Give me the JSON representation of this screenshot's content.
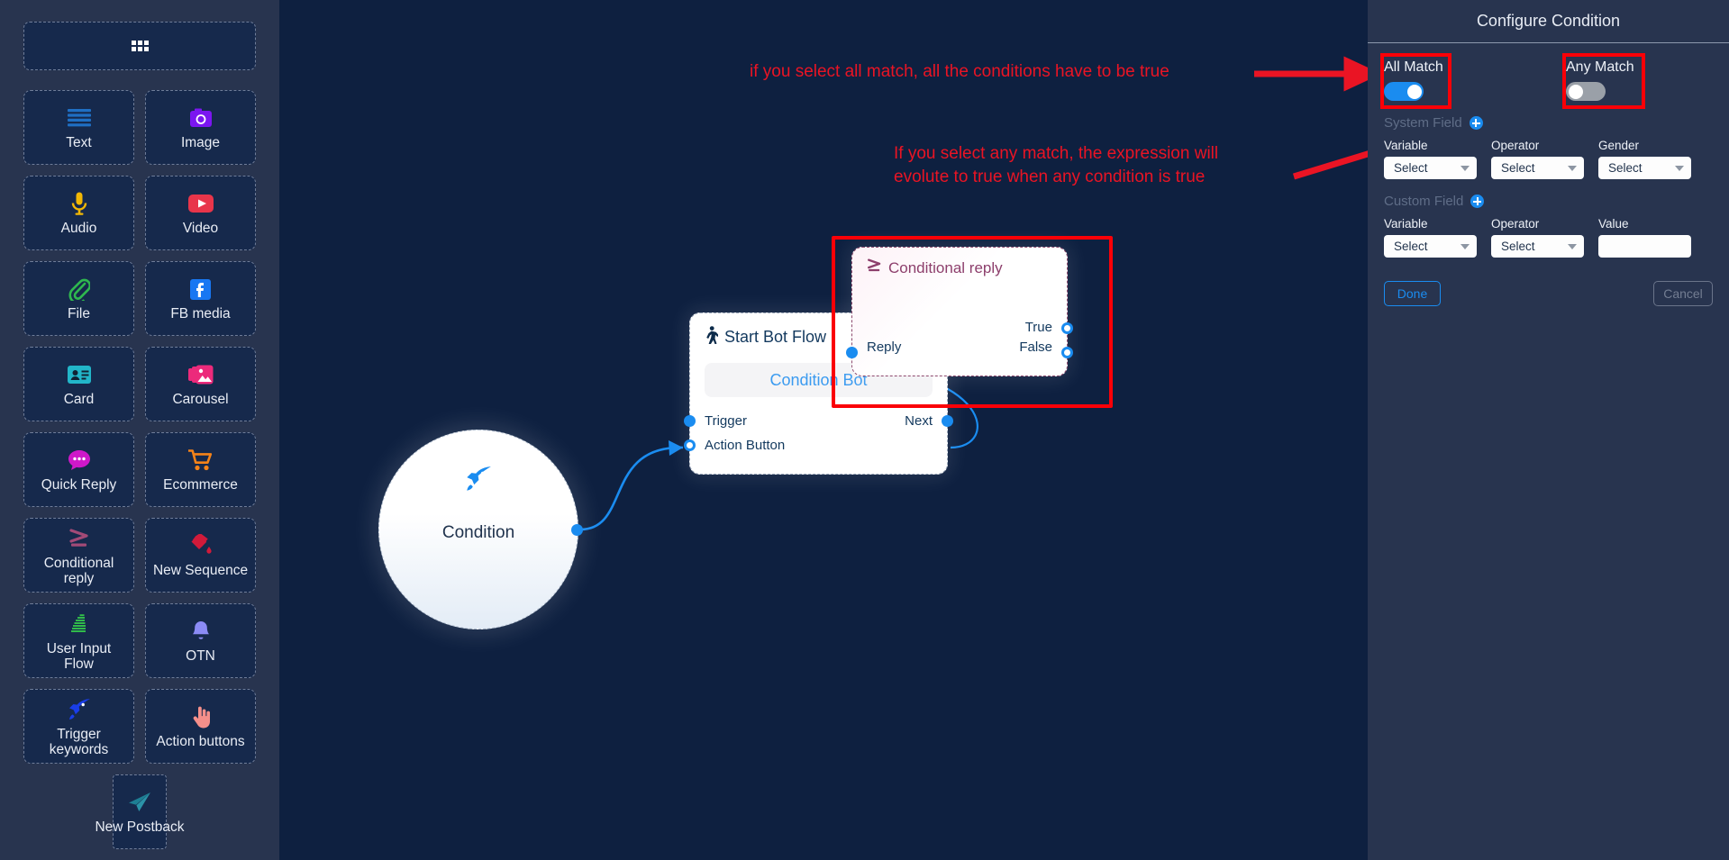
{
  "sidebar": {
    "grid_button": {
      "icon": "grid-icon"
    },
    "tiles": [
      {
        "label": "Text",
        "icon": "lines-icon",
        "color": "#1f6fc4"
      },
      {
        "label": "Image",
        "icon": "camera-icon",
        "color": "#7b16f0"
      },
      {
        "label": "Audio",
        "icon": "microphone-icon",
        "color": "#f2b705"
      },
      {
        "label": "Video",
        "icon": "youtube-icon",
        "color": "#e8354a"
      },
      {
        "label": "File",
        "icon": "paperclip-icon",
        "color": "#2fb84f"
      },
      {
        "label": "FB media",
        "icon": "facebook-icon",
        "color": "#1877f2"
      },
      {
        "label": "Card",
        "icon": "id-card-icon",
        "color": "#22b6c9"
      },
      {
        "label": "Carousel",
        "icon": "images-stack-icon",
        "color": "#ec2a7b"
      },
      {
        "label": "Quick Reply",
        "icon": "chat-bubble-icon",
        "color": "#cf18c9"
      },
      {
        "label": "Ecommerce",
        "icon": "shopping-cart-icon",
        "color": "#f58318"
      },
      {
        "label": "Conditional\nreply",
        "icon": "greater-equal-icon",
        "color": "#a34a77"
      },
      {
        "label": "New Sequence",
        "icon": "paint-bucket-icon",
        "color": "#d11a3a"
      },
      {
        "label": "User Input\nFlow",
        "icon": "stacked-pages-icon",
        "color": "#32c24a"
      },
      {
        "label": "OTN",
        "icon": "bell-icon",
        "color": "#8b8bf5"
      },
      {
        "label": "Trigger\nkeywords",
        "icon": "rocket-icon",
        "color": "#1a3ee8"
      },
      {
        "label": "Action buttons",
        "icon": "pointing-hand-icon",
        "color": "#f58f8a"
      }
    ],
    "postback_tile": {
      "label": "New Postback",
      "icon": "paper-plane-icon",
      "color": "#1e7f94"
    }
  },
  "canvas": {
    "circle_node": {
      "label": "Condition",
      "icon": "rocket-icon"
    },
    "start_node": {
      "title": "Start Bot Flow",
      "icon": "walking-person-icon",
      "chip": "Condition Bot",
      "ports": {
        "trigger": "Trigger",
        "next": "Next",
        "action_button": "Action Button"
      }
    },
    "conditional_node": {
      "title": "Conditional reply",
      "icon": "greater-equal-icon",
      "ports": {
        "true": "True",
        "false": "False",
        "reply": "Reply"
      }
    },
    "annotations": [
      {
        "id": "all-match-note",
        "text": "if you select all match, all the conditions have to be true"
      },
      {
        "id": "any-match-note",
        "text": "If you select any match, the expression will\nevolute to true when any condition is true"
      }
    ]
  },
  "panel": {
    "title": "Configure Condition",
    "all_match": {
      "label": "All Match",
      "state": "on"
    },
    "any_match": {
      "label": "Any Match",
      "state": "off"
    },
    "system_field": {
      "heading": "System Field",
      "add_icon": "plus-circle-icon",
      "fields": [
        {
          "label": "Variable",
          "type": "select",
          "value": "Select"
        },
        {
          "label": "Operator",
          "type": "select",
          "value": "Select"
        },
        {
          "label": "Gender",
          "type": "select",
          "value": "Select"
        }
      ]
    },
    "custom_field": {
      "heading": "Custom Field",
      "add_icon": "plus-circle-icon",
      "fields": [
        {
          "label": "Variable",
          "type": "select",
          "value": "Select"
        },
        {
          "label": "Operator",
          "type": "select",
          "value": "Select"
        },
        {
          "label": "Value",
          "type": "text",
          "value": "",
          "placeholder": ""
        }
      ]
    },
    "done_button": "Done",
    "cancel_button": "Cancel"
  },
  "colors": {
    "accent": "#1a8cf0",
    "annotation": "#ea1424",
    "highlight": "#fb0007",
    "sidebar_bg": "#28344f",
    "canvas_bg": "#0e2040",
    "tile_bg": "#16294c"
  }
}
